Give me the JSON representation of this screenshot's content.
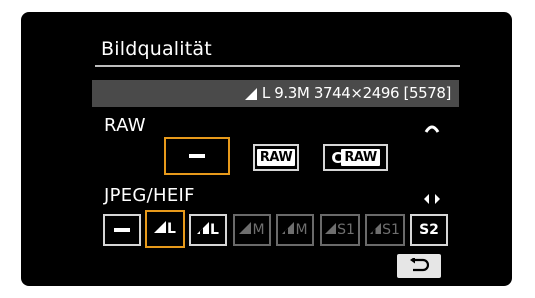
{
  "screen": {
    "title": "Bildqualität",
    "info": {
      "quality_mark": "L",
      "text": "9.3M 3744×2496 [5578]"
    }
  },
  "raw_section": {
    "label": "RAW",
    "dial_icon": "main-dial-icon",
    "options": [
      {
        "id": "off",
        "type": "dash",
        "selected": true
      },
      {
        "id": "raw",
        "label": "RAW",
        "selected": false
      },
      {
        "id": "craw",
        "prefix": "C",
        "label": "RAW",
        "selected": false
      }
    ]
  },
  "jpeg_section": {
    "label": "JPEG/HEIF",
    "nav_icon": "left-right-arrows-icon",
    "options": [
      {
        "id": "off",
        "type": "dash",
        "enabled": true,
        "selected": false
      },
      {
        "id": "L-fine",
        "label": "L",
        "icon": "fine-quality-icon",
        "enabled": true,
        "selected": true
      },
      {
        "id": "L-normal",
        "label": "L",
        "icon": "normal-quality-icon",
        "enabled": true,
        "selected": false
      },
      {
        "id": "M-fine",
        "label": "M",
        "icon": "fine-quality-icon",
        "enabled": false,
        "selected": false
      },
      {
        "id": "M-normal",
        "label": "M",
        "icon": "normal-quality-icon",
        "enabled": false,
        "selected": false
      },
      {
        "id": "S1-fine",
        "label": "S1",
        "icon": "fine-quality-icon",
        "enabled": false,
        "selected": false
      },
      {
        "id": "S1-normal",
        "label": "S1",
        "icon": "normal-quality-icon",
        "enabled": false,
        "selected": false
      },
      {
        "id": "S2",
        "label": "S2",
        "enabled": true,
        "selected": false
      }
    ]
  },
  "back_button": {
    "icon": "return-arrow-icon"
  },
  "colors": {
    "background": "#000000",
    "selection": "#e79a1b",
    "info_bar": "#4a4a4a",
    "disabled": "#6e6e6e"
  }
}
